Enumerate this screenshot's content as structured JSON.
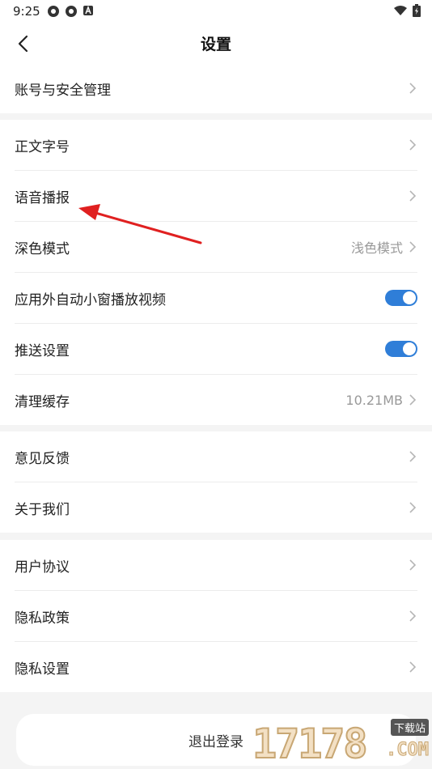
{
  "status_bar": {
    "time": "9:25",
    "icons": [
      "app-icon",
      "app-icon",
      "notification-a-icon",
      "wifi-icon",
      "battery-icon"
    ]
  },
  "header": {
    "title": "设置",
    "back_icon": "chevron-left-icon"
  },
  "groups": [
    {
      "items": [
        {
          "label": "账号与安全管理",
          "type": "link"
        }
      ]
    },
    {
      "items": [
        {
          "label": "正文字号",
          "type": "link"
        },
        {
          "label": "语音播报",
          "type": "link"
        },
        {
          "label": "深色模式",
          "type": "link",
          "value": "浅色模式"
        },
        {
          "label": "应用外自动小窗播放视频",
          "type": "toggle",
          "on": true
        },
        {
          "label": "推送设置",
          "type": "toggle",
          "on": true
        },
        {
          "label": "清理缓存",
          "type": "link",
          "value": "10.21MB"
        }
      ]
    },
    {
      "items": [
        {
          "label": "意见反馈",
          "type": "link"
        },
        {
          "label": "关于我们",
          "type": "link"
        }
      ]
    },
    {
      "items": [
        {
          "label": "用户协议",
          "type": "link"
        },
        {
          "label": "隐私政策",
          "type": "link"
        },
        {
          "label": "隐私设置",
          "type": "link"
        }
      ]
    }
  ],
  "logout_label": "退出登录",
  "colors": {
    "toggle_on": "#2f7ed8",
    "annotation_arrow": "#e02020",
    "chevron": "#b5b5b5"
  },
  "watermark": {
    "number": "17178",
    "tag": "下载站",
    "com": ".COM"
  }
}
